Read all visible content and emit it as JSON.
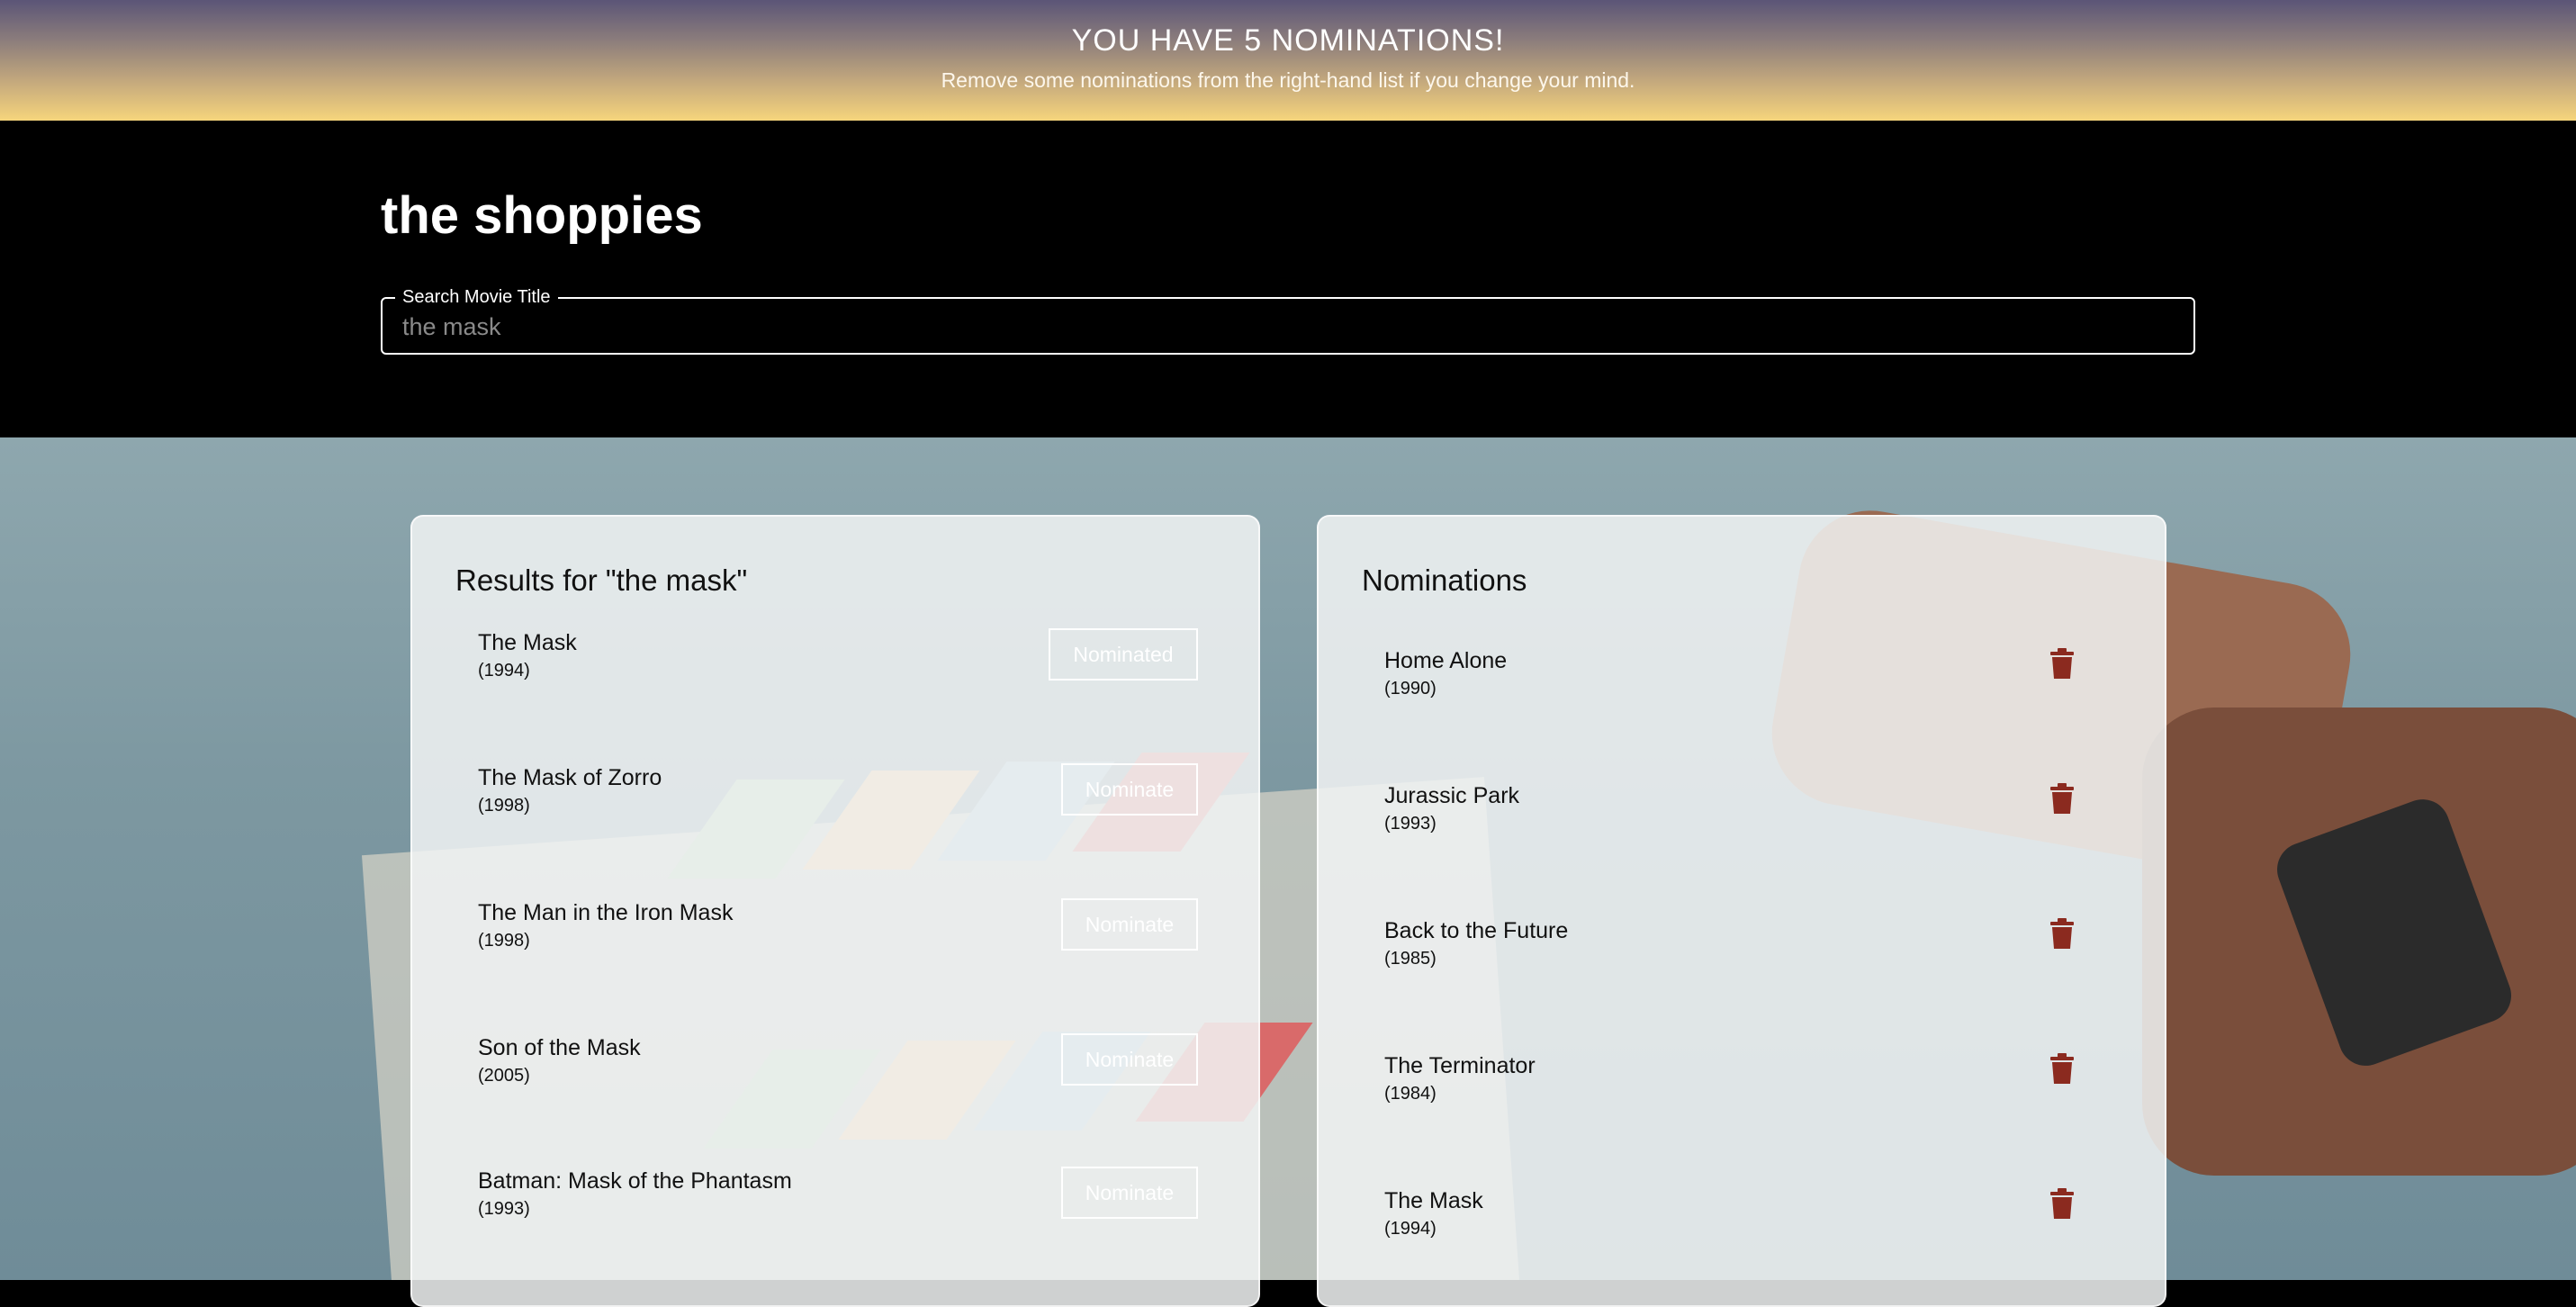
{
  "banner": {
    "title": "YOU HAVE 5 NOMINATIONS!",
    "subtitle": "Remove some nominations from the right-hand list if you change your mind."
  },
  "app": {
    "title": "the shoppies"
  },
  "search": {
    "label": "Search Movie Title",
    "value": "the mask"
  },
  "results": {
    "heading": "Results for \"the mask\"",
    "items": [
      {
        "title": "The Mask",
        "year": "(1994)",
        "button": "Nominated"
      },
      {
        "title": "The Mask of Zorro",
        "year": "(1998)",
        "button": "Nominate"
      },
      {
        "title": "The Man in the Iron Mask",
        "year": "(1998)",
        "button": "Nominate"
      },
      {
        "title": "Son of the Mask",
        "year": "(2005)",
        "button": "Nominate"
      },
      {
        "title": "Batman: Mask of the Phantasm",
        "year": "(1993)",
        "button": "Nominate"
      }
    ]
  },
  "nominations": {
    "heading": "Nominations",
    "items": [
      {
        "title": "Home Alone",
        "year": "(1990)",
        "icon": "trash-icon"
      },
      {
        "title": "Jurassic Park",
        "year": "(1993)",
        "icon": "trash-icon"
      },
      {
        "title": "Back to the Future",
        "year": "(1985)",
        "icon": "trash-icon"
      },
      {
        "title": "The Terminator",
        "year": "(1984)",
        "icon": "trash-icon"
      },
      {
        "title": "The Mask",
        "year": "(1994)",
        "icon": "trash-icon"
      }
    ]
  },
  "colors": {
    "trash": "#8b2a1f",
    "header_bg": "#000000",
    "banner_top": "#5b5577",
    "banner_bottom": "#f6d57c"
  }
}
